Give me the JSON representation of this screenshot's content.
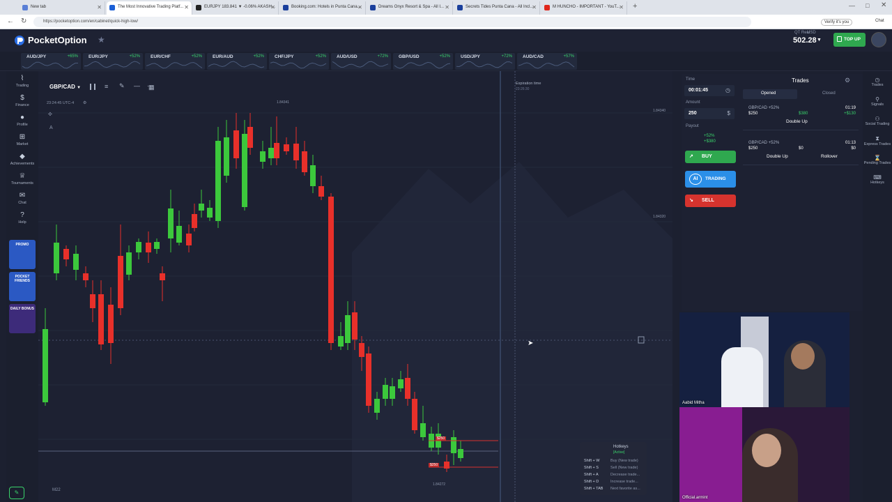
{
  "browser": {
    "tabs": [
      {
        "label": "New tab",
        "color": "#5a7fd6"
      },
      {
        "label": "The Most Innovative Trading Platf...",
        "color": "#1b5fd6"
      },
      {
        "label": "EURJPY 183.841 ▼ -0.06% AKASH...",
        "color": "#222"
      },
      {
        "label": "Booking.com: Hotels in Punta Cana...",
        "color": "#1a3f9c"
      },
      {
        "label": "Dreams Onyx Resort & Spa - All I...",
        "color": "#1a3f9c"
      },
      {
        "label": "Secrets Tides Punta Cana - All Incl...",
        "color": "#1a3f9c"
      },
      {
        "label": "M HUNCHO - IMPORTANT - YouT...",
        "color": "#e0281d"
      }
    ],
    "url": "https://pocketoption.com/en/cabinet/quick-high-low/",
    "verify": "Verify it's you",
    "chat": "Chat"
  },
  "header": {
    "brand": "PocketOption",
    "account_label": "QT Real",
    "usd": "USD",
    "balance": "502.28",
    "topup": "TOP UP"
  },
  "assets": [
    {
      "name": "AUD/JPY",
      "pct": "+65%"
    },
    {
      "name": "EUR/JPY",
      "pct": "+52%"
    },
    {
      "name": "EUR/CHF",
      "pct": "+52%"
    },
    {
      "name": "EUR/AUD",
      "pct": "+52%"
    },
    {
      "name": "CHF/JPY",
      "pct": "+52%"
    },
    {
      "name": "AUD/USD",
      "pct": "+72%"
    },
    {
      "name": "GBP/USD",
      "pct": "+52%"
    },
    {
      "name": "USD/JPY",
      "pct": "+72%"
    },
    {
      "name": "AUD/CAD",
      "pct": "+57%"
    }
  ],
  "leftnav": [
    {
      "label": "Trading",
      "icon": "chart-line-icon"
    },
    {
      "label": "Finance",
      "icon": "dollar-icon"
    },
    {
      "label": "Profile",
      "icon": "user-icon"
    },
    {
      "label": "Market",
      "icon": "cart-icon"
    },
    {
      "label": "Achievements",
      "icon": "diamond-icon"
    },
    {
      "label": "Tournaments",
      "icon": "trophy-icon"
    },
    {
      "label": "Chat",
      "icon": "chat-icon"
    },
    {
      "label": "Help",
      "icon": "help-icon"
    }
  ],
  "promos": [
    "PROMO",
    "POCKET FRIENDS",
    "DAILY BONUS"
  ],
  "chart": {
    "pair": "GBP/CAD",
    "time": "23:24:45 UTC-4",
    "high": "1.84341",
    "price_top": "1.84340",
    "price_mid": "1.84320",
    "low": "1.84272",
    "expiration_label": "Expiration time",
    "expiration_value": "23:26:30",
    "timeframe": "M22",
    "trade1": "$250",
    "trade2": "$250",
    "up_color": "#3cc83c",
    "down_color": "#e8302a"
  },
  "tradepanel": {
    "time_label": "Time",
    "time_value": "00:01:45",
    "amount_label": "Amount",
    "amount_value": "250",
    "payout_label": "Payout",
    "payout_pct": "+52%",
    "payout_value": "+$380",
    "buy": "BUY",
    "ai": "AI",
    "trading": "TRADING",
    "sell": "SELL"
  },
  "trades": {
    "title": "Trades",
    "tab_opened": "Opened",
    "tab_closed": "Closed",
    "items": [
      {
        "pair": "GBP/CAD +52%",
        "amount": "$250",
        "value": "$380",
        "time": "01:19",
        "delta": "+$130",
        "btn": "Double Up"
      },
      {
        "pair": "GBP/CAD +52%",
        "amount": "$250",
        "value": "$0",
        "time": "01:13",
        "delta": "$0",
        "btn": "Double Up",
        "btn2": "Rollover"
      }
    ]
  },
  "rightnav": [
    "Trades",
    "Signals",
    "Social Trading",
    "Express Trades",
    "Pending Trades",
    "Hotkeys"
  ],
  "cams": {
    "cam1": "Aabid Mitha",
    "cam2": "Official.armint"
  },
  "hotkeys": {
    "title": "Hotkeys",
    "status": "[Active]",
    "rows": [
      {
        "key": "Shift + W",
        "desc": "Buy (New trade)"
      },
      {
        "key": "Shift + S",
        "desc": "Sell (New trade)"
      },
      {
        "key": "Shift + A",
        "desc": "Decrease trade..."
      },
      {
        "key": "Shift + D",
        "desc": "Increase trade..."
      },
      {
        "key": "Shift + TAB",
        "desc": "Next favorite as..."
      }
    ]
  }
}
